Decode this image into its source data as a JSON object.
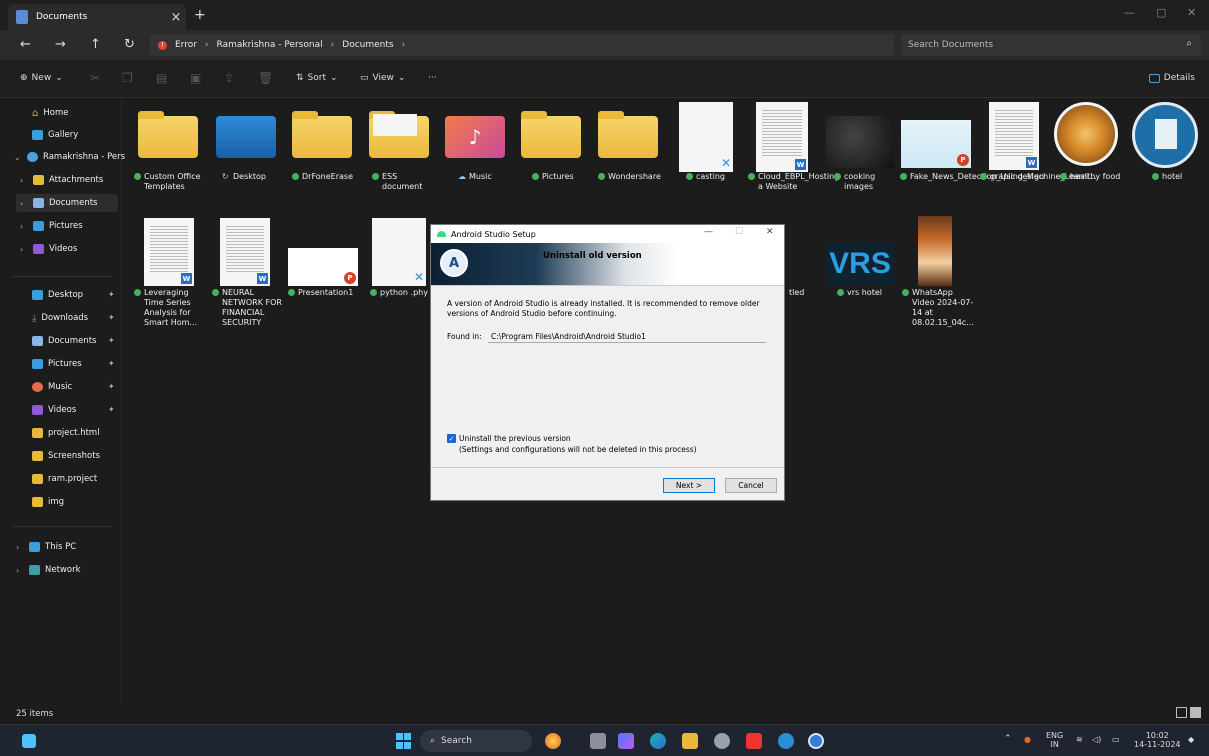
{
  "window": {
    "tab_title": "Documents",
    "close_glyph": "×",
    "add_glyph": "+",
    "controls": [
      "—",
      "▢",
      "✕"
    ]
  },
  "nav": {
    "back": "←",
    "forward": "→",
    "up": "↑",
    "refresh": "↻",
    "breadcrumbs": [
      "Error",
      "Ramakrishna - Personal",
      "Documents"
    ],
    "search_placeholder": "Search Documents"
  },
  "toolbar": {
    "new_label": "New",
    "sort_label": "Sort",
    "view_label": "View",
    "more_label": "···",
    "details_label": "Details"
  },
  "sidebar": {
    "home": "Home",
    "gallery": "Gallery",
    "ramakrishna": "Ramakrishna - Pers",
    "attachments": "Attachments",
    "documents": "Documents",
    "pictures": "Pictures",
    "videos": "Videos",
    "pinned": [
      "Desktop",
      "Downloads",
      "Documents",
      "Pictures",
      "Music",
      "Videos"
    ],
    "folders": [
      "project.html",
      "Screenshots",
      "ram.project",
      "img"
    ],
    "this_pc": "This PC",
    "network": "Network"
  },
  "files_row1": [
    "Custom Office Templates",
    "Desktop",
    "DrFoneErase",
    "ESS document",
    "Music",
    "Pictures",
    "Wondershare",
    "casting",
    "Cloud_EBPL_Hosting a Website",
    "cooking images",
    "Fake_News_Detection_Using_Machine_Learni...",
    "grapic design",
    "healthy food",
    "hotel"
  ],
  "files_row2": [
    "Leveraging Time Series Analysis for Smart Hom...",
    "NEURAL NETWORK FOR FINANCIAL SECURITY",
    "Presentation1",
    "python .phy",
    "tled",
    "vrs hotel",
    "WhatsApp Video 2024-07-14 at 08.02.15_04c..."
  ],
  "vrs_text": "VRS",
  "status": {
    "count": "25 items"
  },
  "dialog": {
    "title": "Android Studio Setup",
    "heading": "Uninstall old version",
    "message": "A version of Android Studio is already installed. It is recommended to remove older versions of Android Studio before continuing.",
    "found_label": "Found in:",
    "found_value": "C:\\Program Files\\Android\\Android Studio1",
    "checkbox_label": "Uninstall the previous version",
    "checkbox_note": "(Settings and configurations will not be deleted in this process)",
    "next_label": "Next >",
    "cancel_label": "Cancel",
    "ctl": [
      "—",
      "☐",
      "✕"
    ]
  },
  "taskbar": {
    "search_label": "Search",
    "lang_top": "ENG",
    "lang_bottom": "IN",
    "time": "10:02",
    "date": "14-11-2024"
  },
  "colors": {
    "accent": "#0078d4",
    "folder": "#e9b93c",
    "ok": "#46b35b",
    "error": "#e0443e"
  }
}
